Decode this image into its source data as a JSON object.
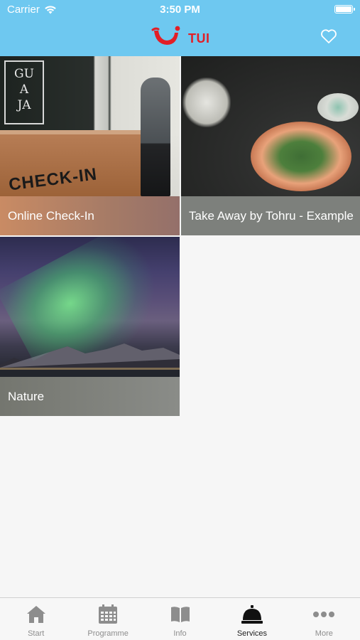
{
  "status_bar": {
    "carrier": "Carrier",
    "time": "3:50 PM"
  },
  "header": {
    "brand": "TUI"
  },
  "tiles": [
    {
      "label": "Online Check-In",
      "image_text": "CHECK-IN",
      "sign_text": "GU\nA\nJA"
    },
    {
      "label": "Take Away by Tohru - Example"
    },
    {
      "label": "Nature"
    }
  ],
  "tabbar": {
    "items": [
      {
        "label": "Start",
        "icon": "home-icon"
      },
      {
        "label": "Programme",
        "icon": "calendar-icon"
      },
      {
        "label": "Info",
        "icon": "book-icon"
      },
      {
        "label": "Services",
        "icon": "service-bell-icon",
        "active": true
      },
      {
        "label": "More",
        "icon": "more-dots-icon"
      }
    ]
  },
  "colors": {
    "header": "#6ec8f0",
    "brand_red": "#e21e26",
    "active_tab": "#222222",
    "inactive_tab": "#8d8d8d"
  }
}
